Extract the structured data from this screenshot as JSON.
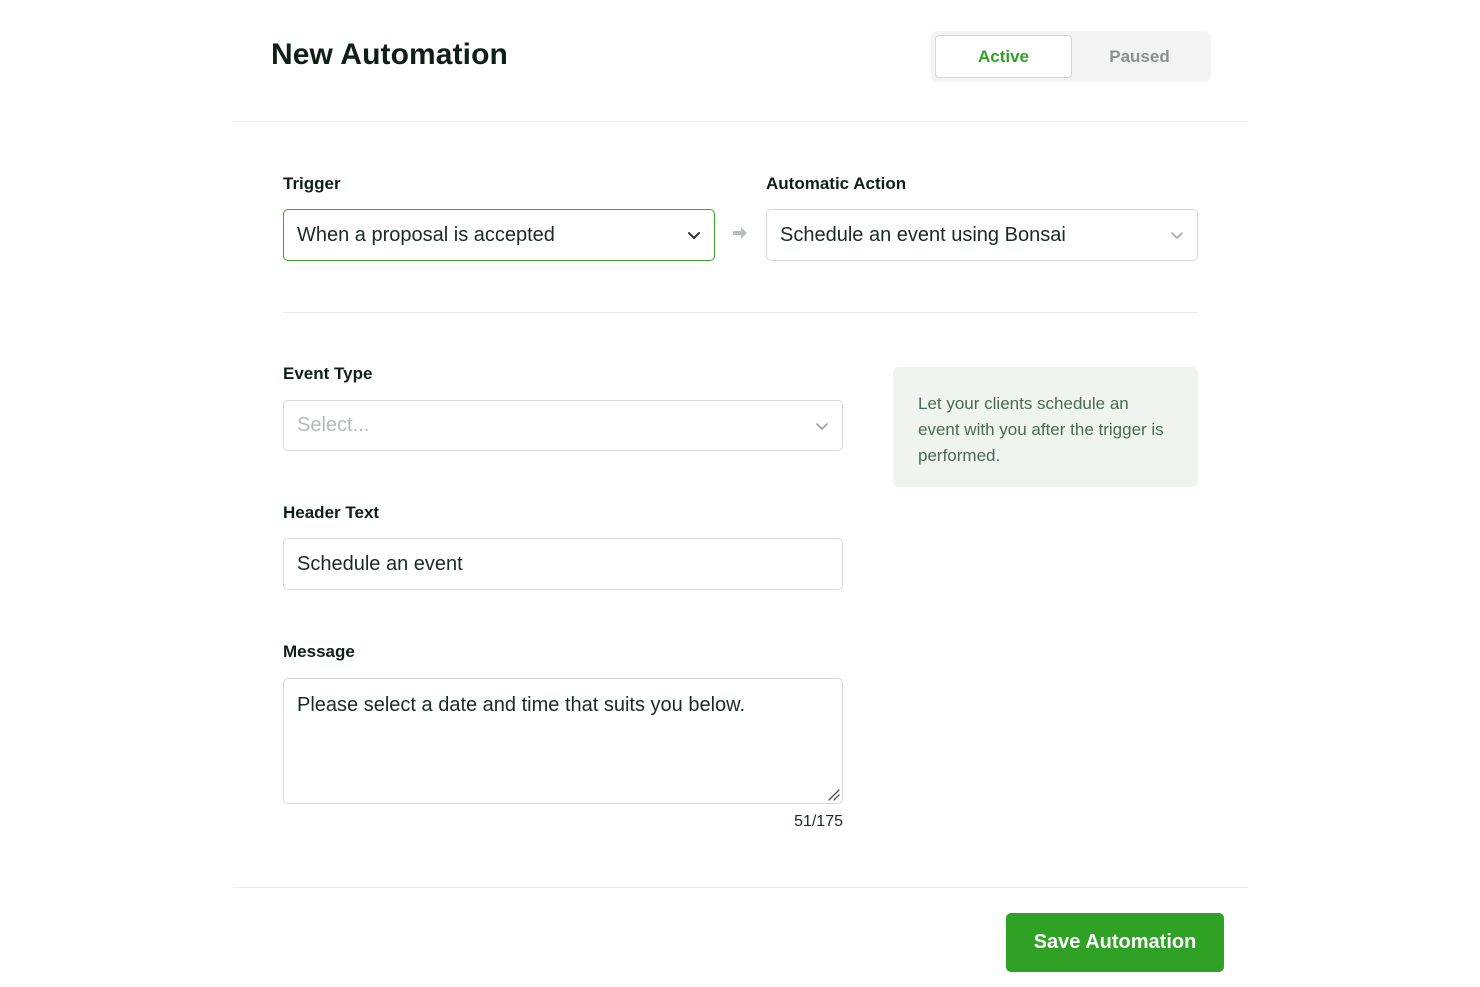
{
  "header": {
    "title": "New Automation",
    "status_toggle": {
      "active_label": "Active",
      "paused_label": "Paused",
      "selected": "Active"
    }
  },
  "trigger": {
    "label": "Trigger",
    "value": "When a proposal is accepted"
  },
  "action": {
    "label": "Automatic Action",
    "value": "Schedule an event using Bonsai"
  },
  "event_type": {
    "label": "Event Type",
    "placeholder": "Select..."
  },
  "header_text": {
    "label": "Header Text",
    "value": "Schedule an event"
  },
  "message": {
    "label": "Message",
    "value": "Please select a date and time that suits you below.",
    "counter": "51/175"
  },
  "info_box": {
    "text": "Let your clients schedule an event with you after the trigger is performed."
  },
  "footer": {
    "save_label": "Save Automation"
  },
  "icons": {
    "chevron": "chevron-down-icon",
    "arrow": "arrow-right-icon",
    "resize": "resize-handle-icon"
  },
  "colors": {
    "accent": "#2fa125",
    "info_bg": "#eff4ee",
    "info_text": "#4b6a53"
  }
}
